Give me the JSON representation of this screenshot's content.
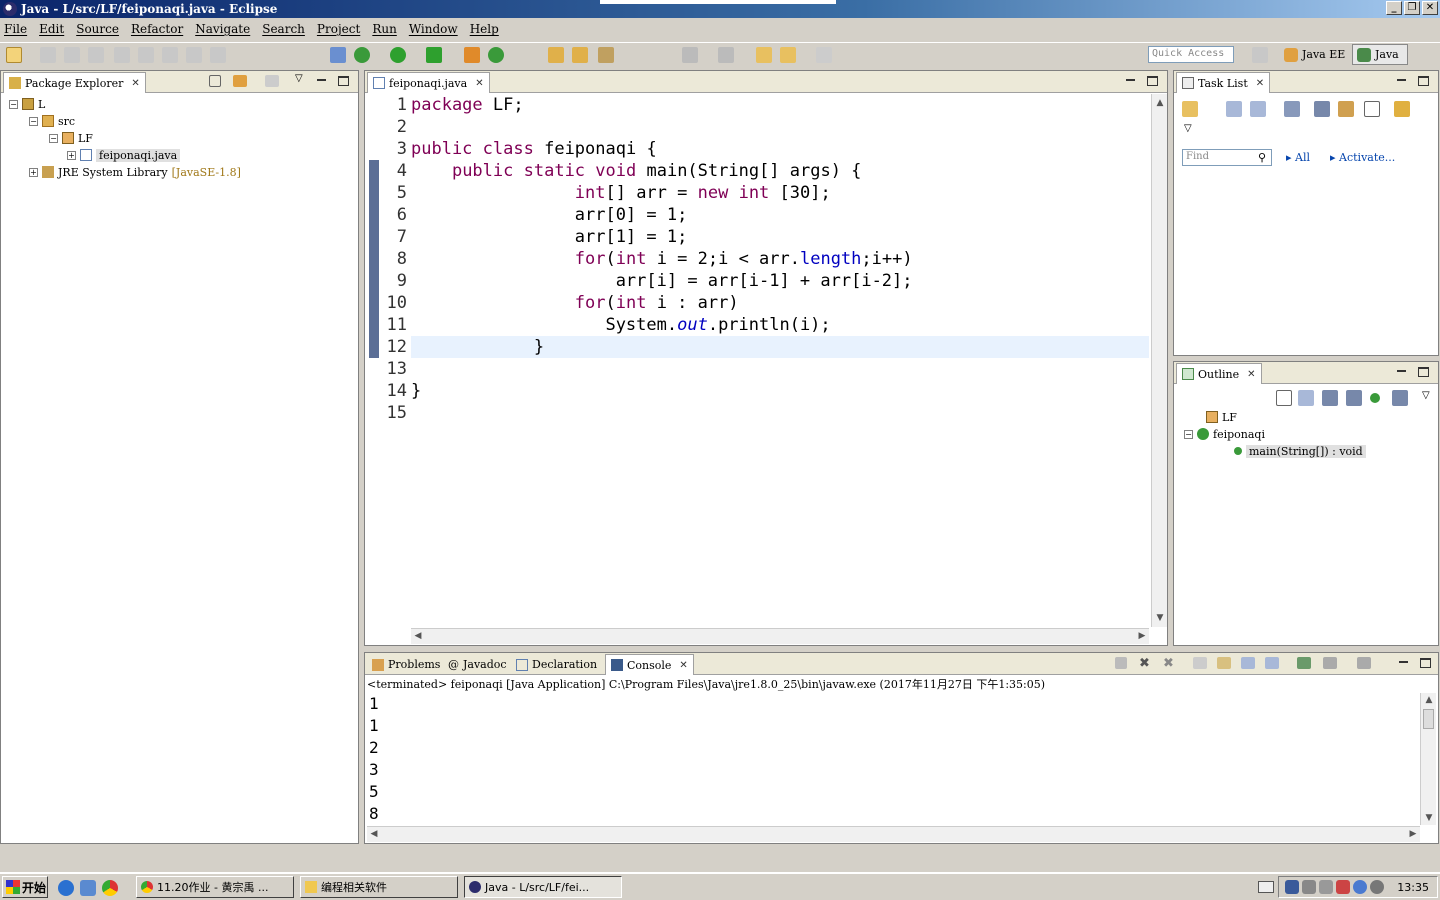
{
  "window": {
    "title": "Java - L/src/LF/feiponaqi.java - Eclipse"
  },
  "menu": [
    "File",
    "Edit",
    "Source",
    "Refactor",
    "Navigate",
    "Search",
    "Project",
    "Run",
    "Window",
    "Help"
  ],
  "toolbar": {
    "quick_access_placeholder": "Quick Access",
    "perspectives": [
      "Java EE",
      "Java"
    ]
  },
  "package_explorer": {
    "tab_label": "Package Explorer",
    "tree": {
      "project": "L",
      "src": "src",
      "package": "LF",
      "file": "feiponaqi.java",
      "jre": "JRE System Library",
      "jre_version": "[JavaSE-1.8]"
    }
  },
  "editor": {
    "tab_label": "feiponaqi.java",
    "line_numbers": [
      "1",
      "2",
      "3",
      "4",
      "5",
      "6",
      "7",
      "8",
      "9",
      "10",
      "11",
      "12",
      "13",
      "14",
      "15"
    ],
    "current_line": 12
  },
  "task_list": {
    "tab_label": "Task List",
    "find_placeholder": "Find",
    "all_label": "All",
    "activate_label": "Activate..."
  },
  "outline": {
    "tab_label": "Outline",
    "package": "LF",
    "class": "feiponaqi",
    "method": "main(String[]) : void"
  },
  "bottom_tabs": {
    "problems": "Problems",
    "javadoc": "Javadoc",
    "declaration": "Declaration",
    "console": "Console"
  },
  "console": {
    "header": "<terminated> feiponaqi [Java Application] C:\\Program Files\\Java\\jre1.8.0_25\\bin\\javaw.exe (2017年11月27日 下午1:35:05)",
    "output": [
      "1",
      "1",
      "2",
      "3",
      "5",
      "8"
    ]
  },
  "taskbar": {
    "start": "开始",
    "tasks": [
      "11.20作业 - 黄宗禹 ...",
      "编程相关软件",
      "Java - L/src/LF/fei..."
    ],
    "clock": "13:35"
  },
  "colors": {
    "keyword": "#7f0055",
    "field": "#0000c0",
    "current_line": "#e8f2fe",
    "title_bar": "#0a246a"
  }
}
